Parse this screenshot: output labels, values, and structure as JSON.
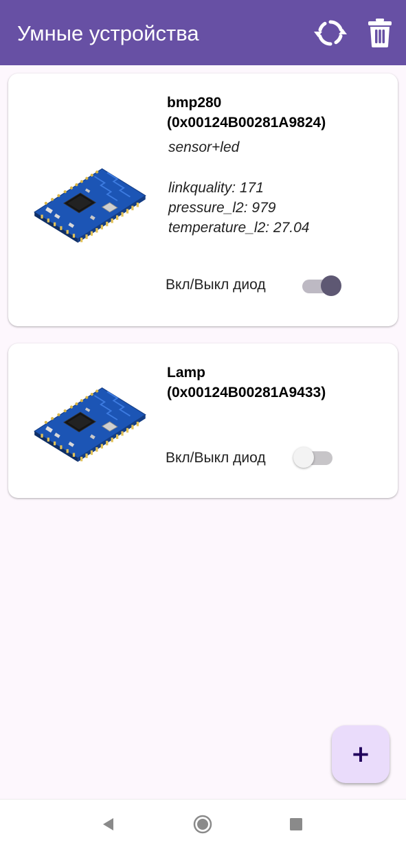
{
  "appbar": {
    "title": "Умные устройства",
    "color": "#6750a4",
    "actions": [
      {
        "icon": "refresh-icon"
      },
      {
        "icon": "trash-icon"
      }
    ]
  },
  "devices": [
    {
      "name_line1": "bmp280",
      "name_line2": "(0x00124B00281A9824)",
      "type": "sensor+led",
      "readings": [
        "linkquality: 171",
        "pressure_l2: 979",
        "temperature_l2: 27.04"
      ],
      "toggle_label": "Вкл/Выкл диод",
      "led_on": true
    },
    {
      "name_line1": "Lamp",
      "name_line2": "(0x00124B00281A9433)",
      "toggle_label": "Вкл/Выкл диод",
      "led_on": false
    }
  ],
  "fab": {
    "label": "+",
    "icon": "plus-icon",
    "color": "#eadcfb"
  },
  "navbar": {
    "buttons": [
      "back-icon",
      "home-icon",
      "recents-icon"
    ]
  }
}
